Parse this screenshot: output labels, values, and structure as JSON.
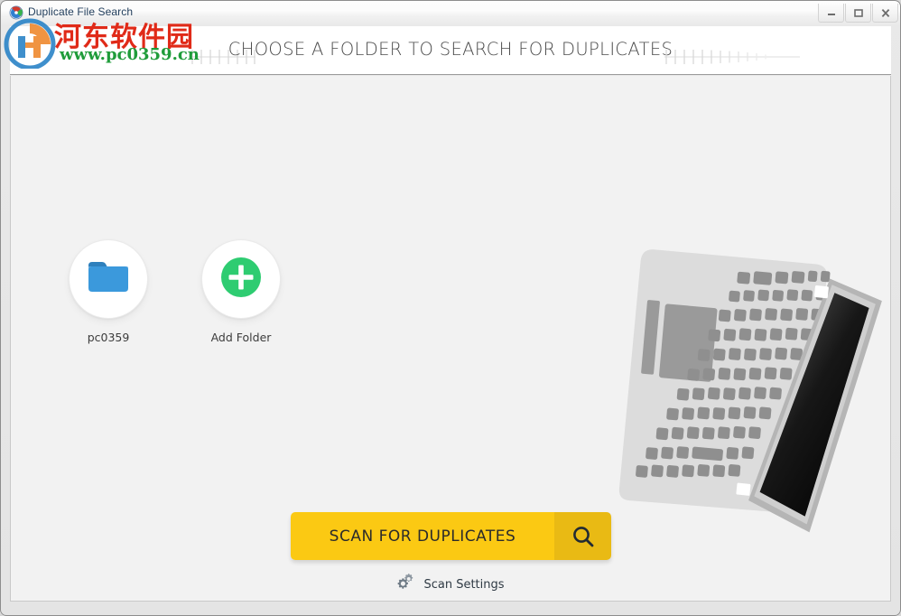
{
  "window": {
    "title": "Duplicate File Search",
    "app_icon": "disc-icon",
    "controls": [
      {
        "name": "minimize-button",
        "glyph": "_"
      },
      {
        "name": "maximize-button",
        "glyph": "□"
      },
      {
        "name": "close-button",
        "glyph": "X"
      }
    ]
  },
  "header": {
    "title": "CHOOSE A FOLDER TO SEARCH FOR DUPLICATES",
    "decoration_left": "ruler-ticks",
    "decoration_right": "ruler-ticks"
  },
  "main": {
    "folders": [
      {
        "label": "pc0359",
        "icon": "folder-icon",
        "type": "folder"
      },
      {
        "label": "Add Folder",
        "icon": "plus-circle-icon",
        "type": "add"
      }
    ],
    "illustration": "laptop-illustration",
    "scan_button": {
      "label": "SCAN FOR DUPLICATES",
      "icon": "magnifier-icon"
    },
    "scan_settings": {
      "label": "Scan Settings",
      "icon": "gears-icon"
    }
  },
  "watermark": {
    "site_name": "河东软件园",
    "url": "www.pc0359.cn",
    "logo": "pc0359-logo"
  },
  "colors": {
    "accent_yellow": "#FBC913",
    "accent_yellow_dark": "#E9BA14",
    "folder_blue": "#3B99DC",
    "add_green": "#2ECC71",
    "panel_bg": "#F2F2F2",
    "header_bg": "#FFFFFF",
    "title_text": "#4A4A4A",
    "watermark_red": "#E02A18",
    "watermark_green": "#1F9C3A"
  }
}
